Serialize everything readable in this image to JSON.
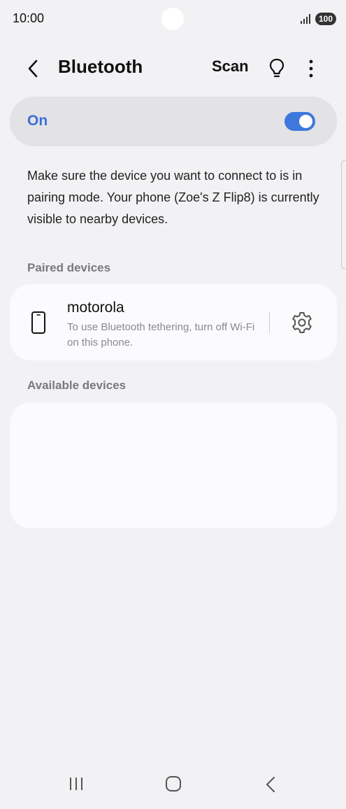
{
  "status_bar": {
    "time": "10:00",
    "battery": "100"
  },
  "header": {
    "title": "Bluetooth",
    "scan_label": "Scan",
    "icons": [
      "back-icon",
      "lightbulb-icon",
      "more-vert-icon"
    ]
  },
  "master_switch": {
    "label": "On",
    "state": true,
    "accent_color": "#3e78dd"
  },
  "info": {
    "text": "Make sure the device you want to connect to is in pairing mode. Your phone (Zoe's Z Flip8) is currently visible to nearby devices."
  },
  "paired": {
    "section_label": "Paired devices",
    "devices": [
      {
        "name": "motorola",
        "subtitle": "To use Bluetooth tethering, turn off Wi-Fi on this phone.",
        "icon": "smartphone-icon",
        "settings_icon": "gear-icon"
      }
    ]
  },
  "available": {
    "section_label": "Available devices",
    "devices": []
  },
  "nav_bar": {
    "icons": [
      "recents-icon",
      "home-icon",
      "back-icon"
    ]
  }
}
